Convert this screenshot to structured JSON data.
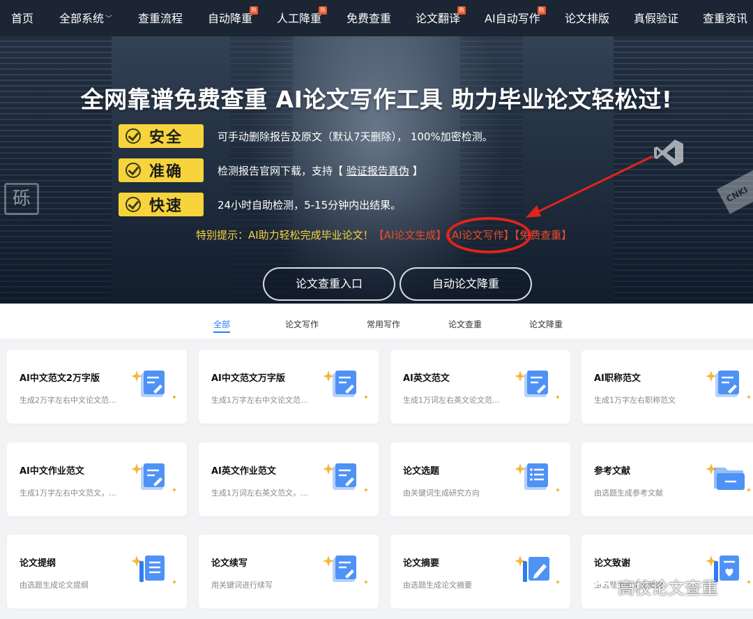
{
  "nav": {
    "items": [
      {
        "label": "首页",
        "hot": false
      },
      {
        "label": "全部系统",
        "hot": false,
        "dropdown": true
      },
      {
        "label": "查重流程",
        "hot": false
      },
      {
        "label": "自动降重",
        "hot": true
      },
      {
        "label": "人工降重",
        "hot": true
      },
      {
        "label": "免费查重",
        "hot": false
      },
      {
        "label": "论文翻译",
        "hot": true
      },
      {
        "label": "AI自动写作",
        "hot": true
      },
      {
        "label": "论文排版",
        "hot": false
      },
      {
        "label": "真假验证",
        "hot": false
      },
      {
        "label": "查重资讯",
        "hot": false
      }
    ],
    "hot_badge": "热"
  },
  "hero": {
    "title": "全网靠谱免费查重 AI论文写作工具 助力毕业论文轻松过!",
    "features": [
      {
        "badge": "安全",
        "text": "可手动删除报告及原文（默认7天删除），  100%加密检测。"
      },
      {
        "badge": "准确",
        "text_before": "检测报告官网下载，支持【 ",
        "link": "验证报告真伪",
        "text_after": " 】"
      },
      {
        "badge": "快速",
        "text": "24小时自助检测，5-15分钟内出结果。"
      }
    ],
    "tip_prefix": "特别提示：AI助力轻松完成毕业论文！",
    "tip_links": [
      "【AI论文生成】",
      "【AI论文写作】",
      "【免费查重】"
    ],
    "buttons": [
      "论文查重入口",
      "自动论文降重"
    ],
    "deco_left": "砾",
    "deco_cnki": "CNKI"
  },
  "tabs": [
    "全部",
    "论文写作",
    "常用写作",
    "论文查重",
    "论文降重"
  ],
  "cards": [
    {
      "title": "AI中文范文2万字版",
      "desc": "生成2万字左右中文论文范...",
      "icon": "document-pen-icon"
    },
    {
      "title": "AI中文范文万字版",
      "desc": "生成1万字左右中文论文范...",
      "icon": "document-pen-icon"
    },
    {
      "title": "AI英文范文",
      "desc": "生成1万词左右英文论文范...",
      "icon": "document-pen-icon"
    },
    {
      "title": "AI职称范文",
      "desc": "生成1万字左右职称范文",
      "icon": "document-pen-icon"
    },
    {
      "title": "AI中文作业范文",
      "desc": "生成1万字左右中文范文，...",
      "icon": "document-pen-icon"
    },
    {
      "title": "AI英文作业范文",
      "desc": "生成1万词左右英文范文，...",
      "icon": "document-pen-icon"
    },
    {
      "title": "论文选题",
      "desc": "由关键词生成研究方向",
      "icon": "list-document-icon"
    },
    {
      "title": "参考文献",
      "desc": "由选题生成参考文献",
      "icon": "folder-icon"
    },
    {
      "title": "论文提纲",
      "desc": "由选题生成论文提纲",
      "icon": "outline-document-icon"
    },
    {
      "title": "论文续写",
      "desc": "用关键词进行续写",
      "icon": "document-pen-icon"
    },
    {
      "title": "论文摘要",
      "desc": "由选题生成论文摘要",
      "icon": "pen-square-icon"
    },
    {
      "title": "论文致谢",
      "desc": "由选题生成论文致谢",
      "icon": "document-heart-icon"
    }
  ],
  "watermark": "高校论文查重",
  "colors": {
    "nav_bg": "#1b2533",
    "accent": "#2b7cf7",
    "badge_yellow": "#f7d43c",
    "tip_red": "#ee4a2a",
    "circle_red": "#e3231b"
  }
}
